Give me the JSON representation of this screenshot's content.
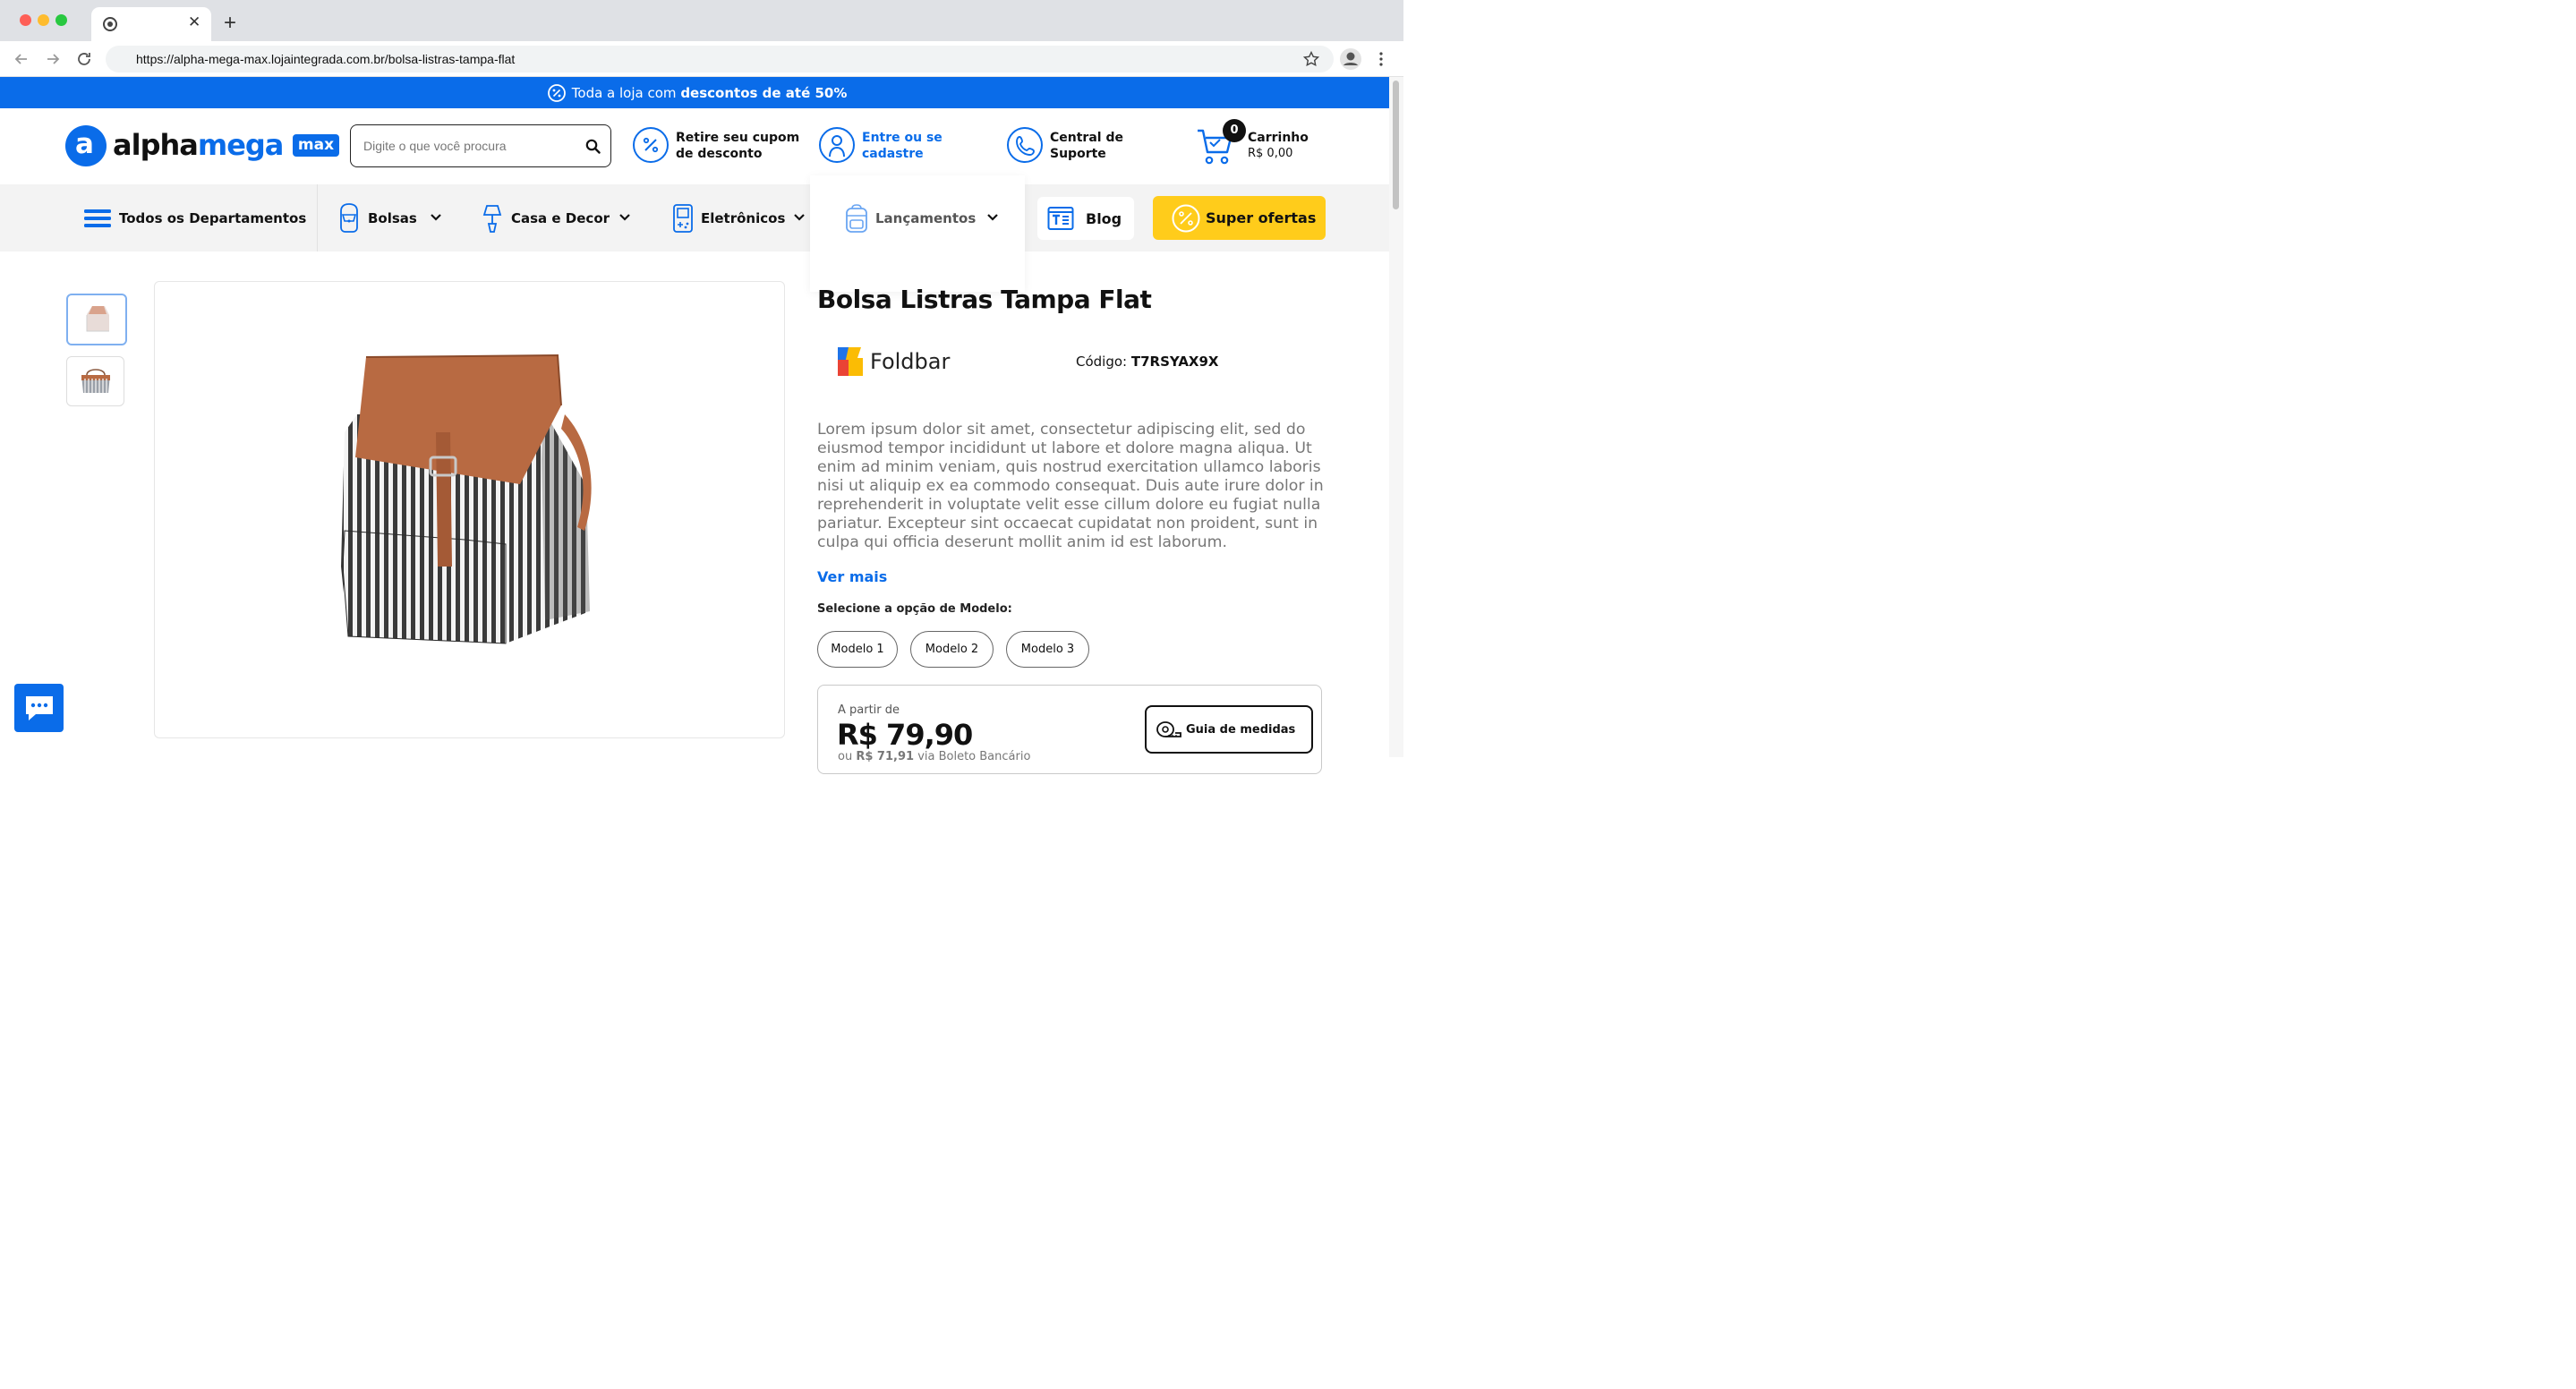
{
  "browser": {
    "url": "https://alpha-mega-max.lojaintegrada.com.br/bolsa-listras-tampa-flat"
  },
  "promo": {
    "prefix": "Toda a loja com",
    "highlight": "descontos de até 50%"
  },
  "header": {
    "logo_letter": "a",
    "logo_alpha": "alpha",
    "logo_mega": "mega",
    "logo_max": "max",
    "search_placeholder": "Digite o que você procura",
    "coupon_line1": "Retire seu cupom",
    "coupon_line2": "de desconto",
    "login_line1": "Entre ou se",
    "login_line2": "cadastre",
    "support_line1": "Central de",
    "support_line2": "Suporte",
    "cart_count": "0",
    "cart_label": "Carrinho",
    "cart_total": "R$ 0,00"
  },
  "nav": {
    "all_departments": "Todos os Departamentos",
    "bags": "Bolsas",
    "home_decor": "Casa e Decor",
    "electronics": "Eletrônicos",
    "launches": "Lançamentos",
    "blog": "Blog",
    "offers": "Super ofertas"
  },
  "product": {
    "title": "Bolsa Listras Tampa Flat",
    "brand": "Foldbar",
    "code_label": "Código:",
    "code_value": "T7RSYAX9X",
    "description": "Lorem ipsum dolor sit amet, consectetur adipiscing elit, sed do eiusmod tempor incididunt ut labore et dolore magna aliqua. Ut enim ad minim veniam, quis nostrud exercitation ullamco laboris nisi ut aliquip ex ea commodo consequat. Duis aute irure dolor in reprehenderit in voluptate velit esse cillum dolore eu fugiat nulla pariatur. Excepteur sint occaecat cupidatat non proident, sunt in culpa qui officia deserunt mollit anim id est laborum.",
    "see_more": "Ver mais",
    "model_label": "Selecione a opção de Modelo:",
    "models": [
      "Modelo 1",
      "Modelo 2",
      "Modelo 3"
    ],
    "price_from": "A partir de",
    "price": "R$ 79,90",
    "boleto_prefix": "ou",
    "boleto_price": "R$ 71,91",
    "boleto_suffix": "via Boleto Bancário",
    "size_guide": "Guia de medidas"
  },
  "colors": {
    "brand_blue": "#0a6ce9",
    "offer_yellow": "#ffcc1b",
    "brown_leather": "#b86a42"
  }
}
